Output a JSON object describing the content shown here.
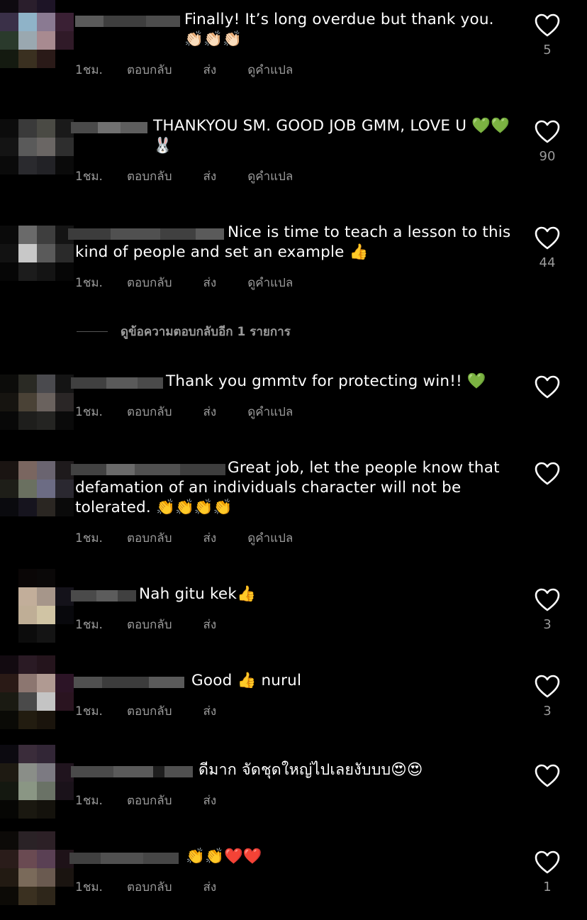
{
  "labels": {
    "reply": "ตอบกลับ",
    "send": "ส่ง",
    "translate": "ดูคำแปล"
  },
  "view_more_replies": "ดูข้อความตอบกลับอีก 1 รายการ",
  "comments": [
    {
      "text": "Finally! It’s long overdue but thank you. 👏🏻👏🏻👏🏻",
      "time": "1ชม.",
      "likes": "5",
      "translate": true
    },
    {
      "text": "THANKYOU SM. GOOD JOB GMM, LOVE U 💚💚🐰",
      "time": "1ชม.",
      "likes": "90",
      "translate": true
    },
    {
      "text": "Nice is time to teach a lesson to this kind of people and set an example 👍",
      "time": "1ชม.",
      "likes": "44",
      "translate": true
    },
    {
      "text": "Thank you gmmtv for protecting win!! 💚",
      "time": "1ชม.",
      "likes": "",
      "translate": true
    },
    {
      "text": "Great job, let the people know that defamation of an individuals character will not be tolerated. 👏👏👏👏",
      "time": "1ชม.",
      "likes": "",
      "translate": true
    },
    {
      "text": "Nah gitu kek👍",
      "time": "1ชม.",
      "likes": "3",
      "translate": false
    },
    {
      "text": "Good 👍 nurul",
      "time": "1ชม.",
      "likes": "3",
      "translate": false
    },
    {
      "text": "ดีมาก จัดชุดใหญ่ไปเลยงับบบ😍😍",
      "time": "1ชม.",
      "likes": "",
      "translate": false
    },
    {
      "text": "👏👏❤️❤️",
      "time": "1ชม.",
      "likes": "1",
      "translate": false
    }
  ],
  "colors": {
    "background": "#000000",
    "text": "#ffffff",
    "secondary": "#9b9b9b"
  },
  "icons": {
    "like": "heart-outline-icon"
  }
}
